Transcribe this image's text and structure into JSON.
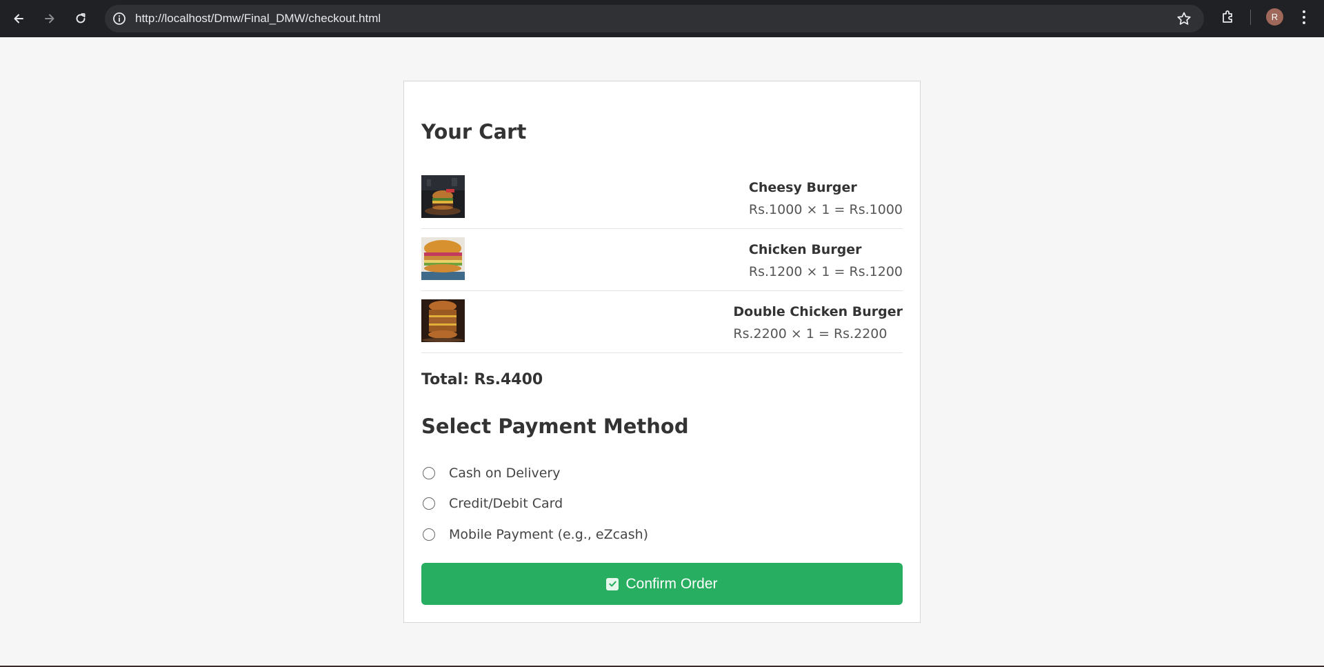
{
  "browser": {
    "url": "http://localhost/Dmw/Final_DMW/checkout.html",
    "profile_initial": "R",
    "icons": [
      "back-arrow-icon",
      "forward-arrow-icon",
      "reload-icon",
      "info-icon",
      "star-icon",
      "extensions-icon",
      "menu-icon"
    ]
  },
  "cart": {
    "title": "Your Cart",
    "items": [
      {
        "name": "Cheesy Burger",
        "price_line": "Rs.1000 × 1 = Rs.1000",
        "image": "cheesy-burger-image"
      },
      {
        "name": "Chicken Burger",
        "price_line": "Rs.1200 × 1 = Rs.1200",
        "image": "chicken-burger-image"
      },
      {
        "name": "Double Chicken Burger",
        "price_line": "Rs.2200 × 1 = Rs.2200",
        "image": "double-chicken-burger-image"
      }
    ],
    "total": "Total: Rs.4400"
  },
  "payment": {
    "title": "Select Payment Method",
    "options": [
      "Cash on Delivery",
      "Credit/Debit Card",
      "Mobile Payment (e.g., eZcash)"
    ]
  },
  "confirm": {
    "label": "Confirm Order",
    "color": "#27ae60"
  }
}
